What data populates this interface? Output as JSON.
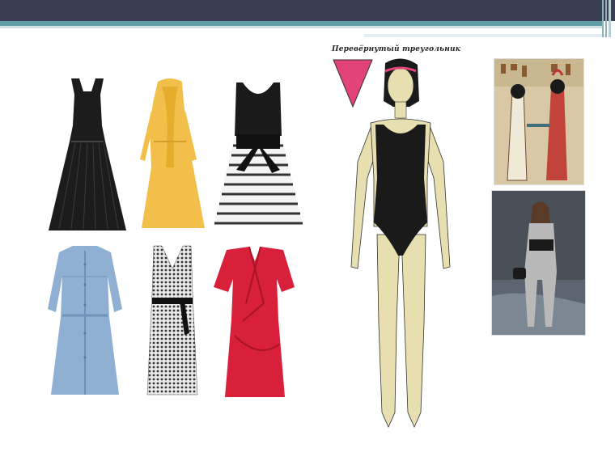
{
  "slide": {
    "title": "Перевёрнутый треугольник"
  },
  "colors": {
    "header_bar": "#3b3f55",
    "header_accent": "#5f9ea3",
    "triangle": "#e2447a",
    "skin": "#e8dfb0",
    "swimsuit": "#1a1a1a"
  },
  "garments": [
    {
      "kind": "halter-pleated-dress",
      "color": "#1c1c1c"
    },
    {
      "kind": "yellow-tie-neck-dress",
      "color": "#f2c04a"
    },
    {
      "kind": "striped-skirt-dress",
      "color": "#222222"
    },
    {
      "kind": "denim-shirt-dress",
      "color": "#8fb0d2"
    },
    {
      "kind": "print-wrap-dress",
      "color": "#7a7a7a"
    },
    {
      "kind": "red-wrap-dress",
      "color": "#d8203a"
    }
  ]
}
